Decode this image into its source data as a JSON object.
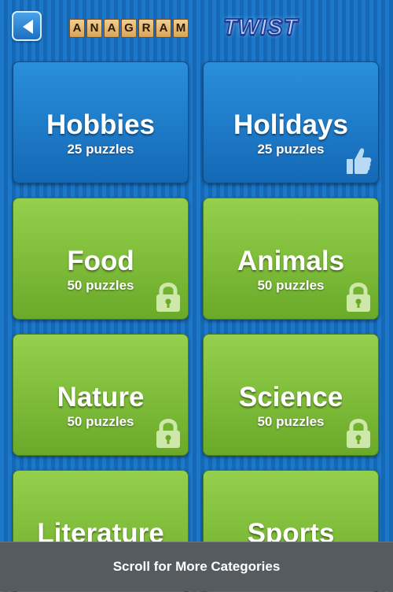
{
  "header": {
    "logo_letters": [
      "A",
      "N",
      "A",
      "G",
      "R",
      "A",
      "M"
    ],
    "logo_twist": "TWIST",
    "back_icon": "back-arrow-icon"
  },
  "categories": [
    {
      "name": "Hobbies",
      "count": "25 puzzles",
      "color": "#1f7fcf",
      "status": "unlocked"
    },
    {
      "name": "Holidays",
      "count": "25 puzzles",
      "color": "#1f7fcf",
      "status": "liked"
    },
    {
      "name": "Food",
      "count": "50 puzzles",
      "color": "#7dbd3a",
      "status": "locked"
    },
    {
      "name": "Animals",
      "count": "50 puzzles",
      "color": "#7dbd3a",
      "status": "locked"
    },
    {
      "name": "Nature",
      "count": "50 puzzles",
      "color": "#7dbd3a",
      "status": "locked"
    },
    {
      "name": "Science",
      "count": "50 puzzles",
      "color": "#7dbd3a",
      "status": "locked"
    },
    {
      "name": "Literature",
      "color": "#7dbd3a"
    },
    {
      "name": "Sports",
      "color": "#7dbd3a"
    }
  ],
  "footer": {
    "text": "Scroll for More Categories"
  }
}
